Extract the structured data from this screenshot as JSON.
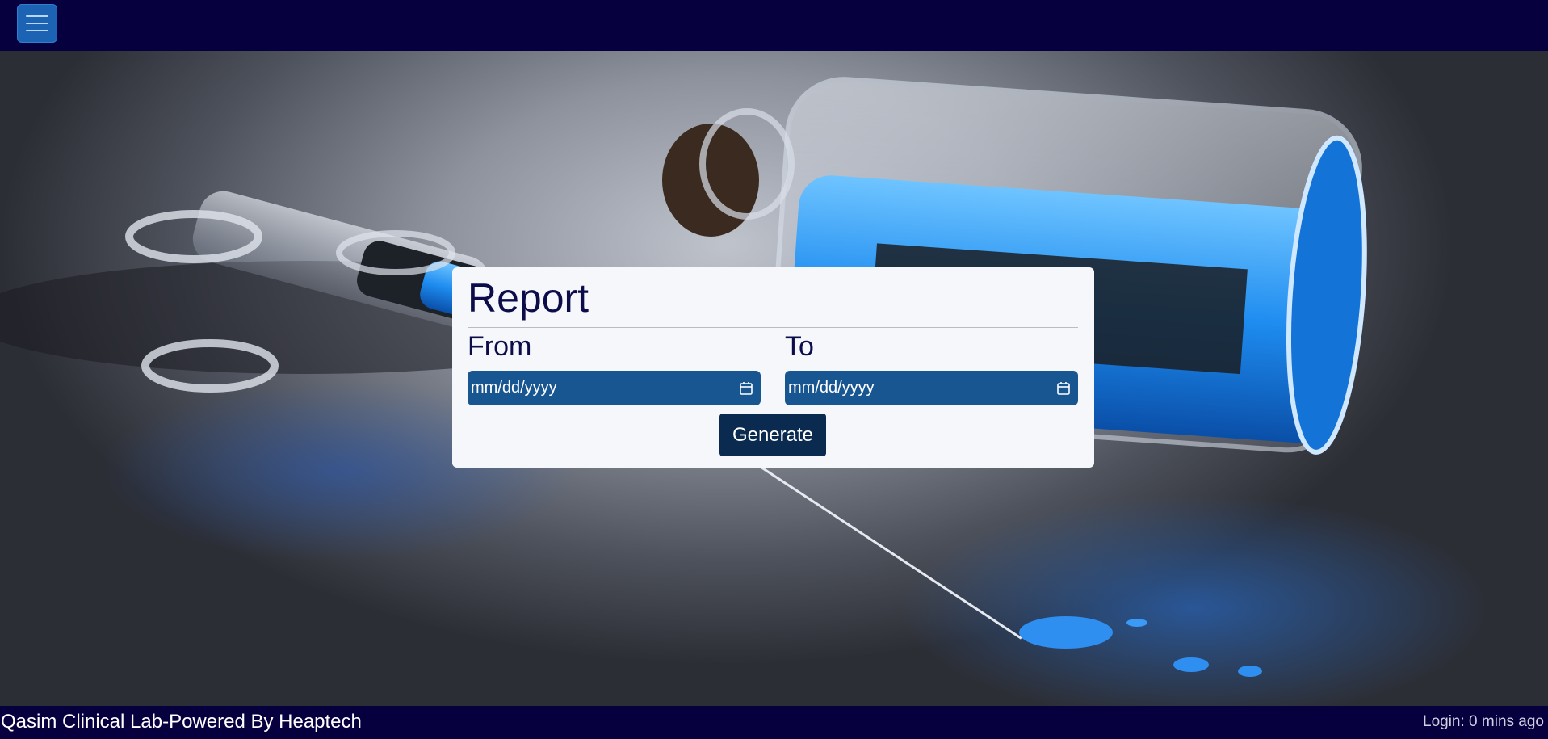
{
  "header": {
    "menu_icon": "hamburger-menu-icon"
  },
  "report": {
    "title": "Report",
    "from_label": "From",
    "to_label": "To",
    "from_value": "mm/dd/yyyy",
    "to_value": "mm/dd/yyyy",
    "calendar_icon": "calendar-icon",
    "generate_label": "Generate"
  },
  "footer": {
    "brand": "Qasim Clinical Lab-Powered By Heaptech",
    "login_status": "Login: 0 mins ago"
  },
  "colors": {
    "topbar": "#07003f",
    "menu_button": "#1c63b3",
    "input_bg": "#185692",
    "button_bg": "#0a2a50",
    "card_bg": "#f5f7fa",
    "heading_text": "#0c0c4a"
  }
}
